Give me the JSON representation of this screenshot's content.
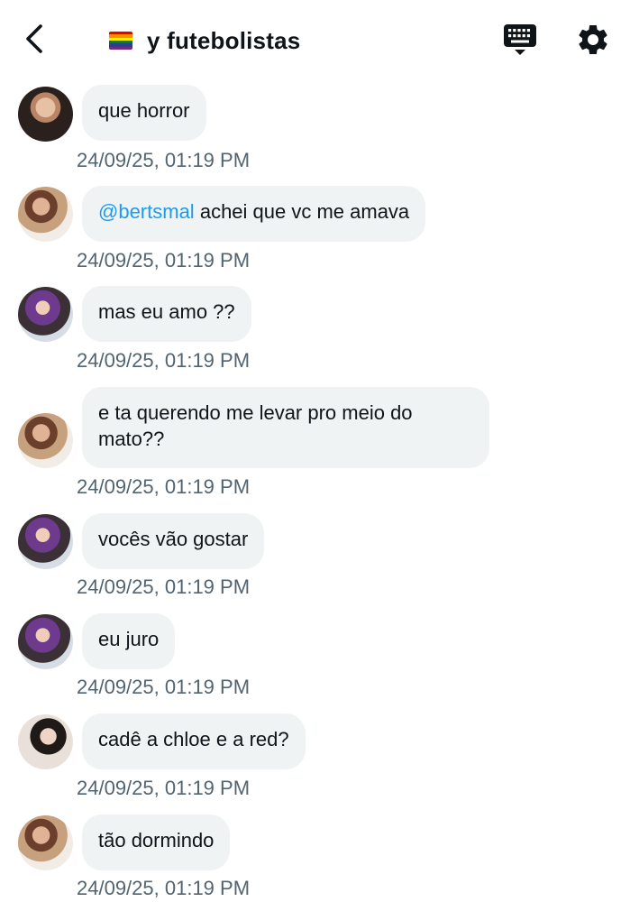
{
  "header": {
    "flag_icon": "rainbow-flag-icon",
    "title": "y futebolistas",
    "flag_colors": [
      "#e40303",
      "#ff8c00",
      "#ffed00",
      "#008026",
      "#24408e",
      "#732982"
    ]
  },
  "messages": [
    {
      "text": "que horror",
      "timestamp": "24/09/25, 01:19 PM"
    },
    {
      "mention": "@bertsmal",
      "text": "achei que vc me amava",
      "timestamp": "24/09/25, 01:19 PM"
    },
    {
      "text": "mas eu amo ??",
      "timestamp": "24/09/25, 01:19 PM"
    },
    {
      "text": "e ta querendo me levar pro meio do mato??",
      "timestamp": "24/09/25, 01:19 PM"
    },
    {
      "text": "vocês vão gostar",
      "timestamp": "24/09/25, 01:19 PM"
    },
    {
      "text": "eu juro",
      "timestamp": "24/09/25, 01:19 PM"
    },
    {
      "text": "cadê a chloe e a red?",
      "timestamp": "24/09/25, 01:19 PM"
    },
    {
      "text": "tão dormindo",
      "timestamp": "24/09/25, 01:19 PM"
    }
  ]
}
